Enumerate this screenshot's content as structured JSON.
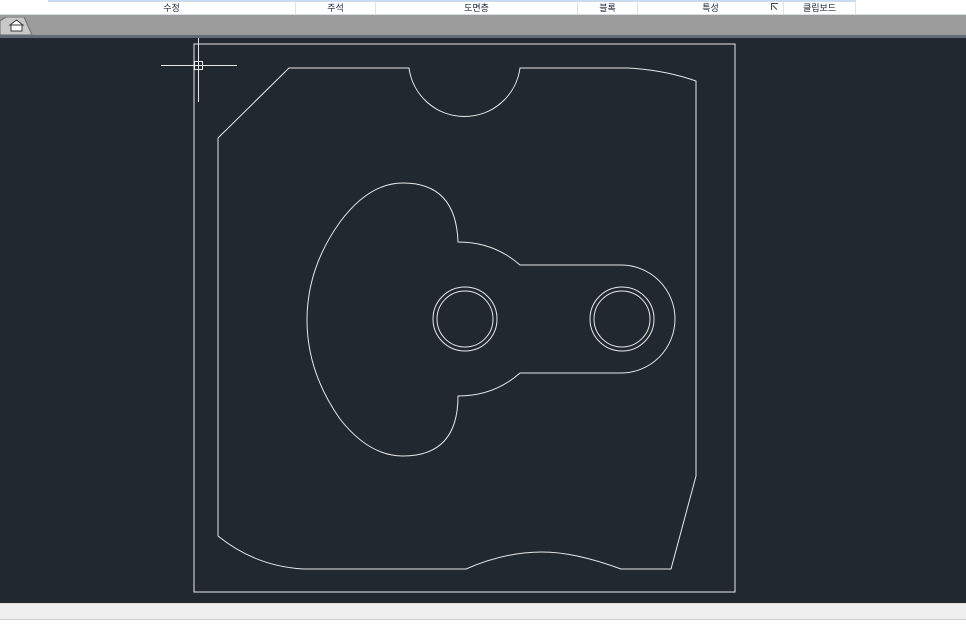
{
  "ribbon": {
    "panels": [
      {
        "label": "수정"
      },
      {
        "label": "주석"
      },
      {
        "label": "도면층"
      },
      {
        "label": "블록"
      },
      {
        "label": "특성"
      },
      {
        "label": "클립보드"
      }
    ]
  },
  "icons": {
    "properties_launcher": "dialog-launcher-icon",
    "file_tab": "home-tab-icon",
    "cursor": "crosshair-cursor-icon"
  },
  "colors": {
    "canvas_bg": "#212830",
    "drawing_lines": "#e8e8e8",
    "tabbar_bg": "#9b9b9b"
  }
}
